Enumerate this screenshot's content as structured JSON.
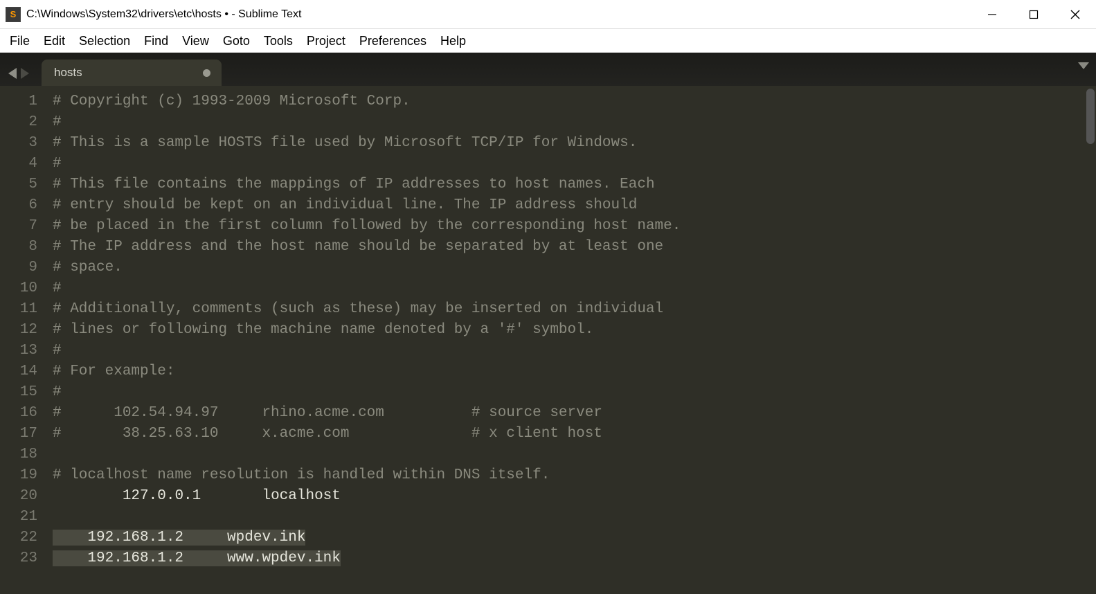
{
  "window": {
    "title": "C:\\Windows\\System32\\drivers\\etc\\hosts • - Sublime Text",
    "icon_letter": "S"
  },
  "menubar": [
    "File",
    "Edit",
    "Selection",
    "Find",
    "View",
    "Goto",
    "Tools",
    "Project",
    "Preferences",
    "Help"
  ],
  "tab": {
    "name": "hosts",
    "dirty": true
  },
  "editor": {
    "lines": [
      {
        "n": 1,
        "t": "# Copyright (c) 1993-2009 Microsoft Corp.",
        "c": true
      },
      {
        "n": 2,
        "t": "#",
        "c": true
      },
      {
        "n": 3,
        "t": "# This is a sample HOSTS file used by Microsoft TCP/IP for Windows.",
        "c": true
      },
      {
        "n": 4,
        "t": "#",
        "c": true
      },
      {
        "n": 5,
        "t": "# This file contains the mappings of IP addresses to host names. Each",
        "c": true
      },
      {
        "n": 6,
        "t": "# entry should be kept on an individual line. The IP address should",
        "c": true
      },
      {
        "n": 7,
        "t": "# be placed in the first column followed by the corresponding host name.",
        "c": true
      },
      {
        "n": 8,
        "t": "# The IP address and the host name should be separated by at least one",
        "c": true
      },
      {
        "n": 9,
        "t": "# space.",
        "c": true
      },
      {
        "n": 10,
        "t": "#",
        "c": true
      },
      {
        "n": 11,
        "t": "# Additionally, comments (such as these) may be inserted on individual",
        "c": true
      },
      {
        "n": 12,
        "t": "# lines or following the machine name denoted by a '#' symbol.",
        "c": true
      },
      {
        "n": 13,
        "t": "#",
        "c": true
      },
      {
        "n": 14,
        "t": "# For example:",
        "c": true
      },
      {
        "n": 15,
        "t": "#",
        "c": true
      },
      {
        "n": 16,
        "t": "#      102.54.94.97     rhino.acme.com          # source server",
        "c": true
      },
      {
        "n": 17,
        "t": "#       38.25.63.10     x.acme.com              # x client host",
        "c": true
      },
      {
        "n": 18,
        "t": "",
        "c": false
      },
      {
        "n": 19,
        "t": "# localhost name resolution is handled within DNS itself.",
        "c": true
      },
      {
        "n": 20,
        "t": "\t127.0.0.1       localhost",
        "c": false
      },
      {
        "n": 21,
        "t": "",
        "c": false
      },
      {
        "n": 22,
        "t": "    192.168.1.2     wpdev.ink",
        "c": false,
        "sel": true
      },
      {
        "n": 23,
        "t": "    192.168.1.2     www.wpdev.ink",
        "c": false,
        "sel": true
      }
    ]
  }
}
